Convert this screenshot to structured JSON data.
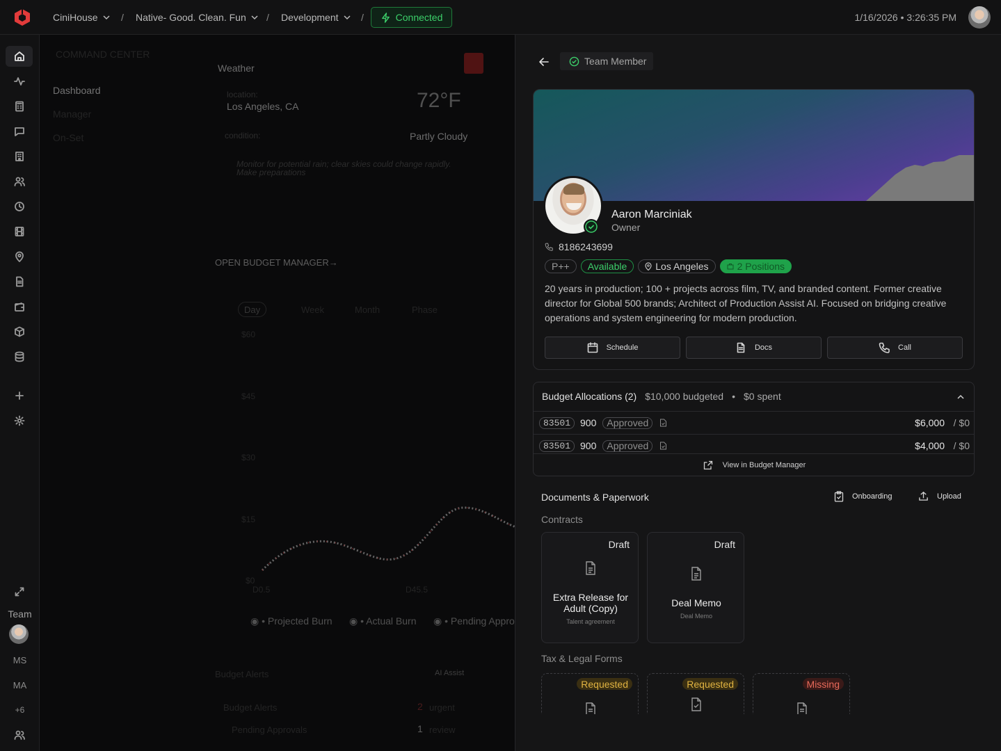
{
  "topbar": {
    "workspace": "CiniHouse",
    "project": "Native- Good. Clean. Fun",
    "phase": "Development",
    "status": "Connected",
    "datetime": "1/16/2026 • 3:26:35 PM"
  },
  "sidebar": {
    "items": [
      "home",
      "activity",
      "calculator",
      "messages",
      "building",
      "users",
      "clock",
      "film",
      "location",
      "document",
      "wallet",
      "package",
      "database",
      "add",
      "settings"
    ],
    "team_label": "Team",
    "team_initials": [
      "MS",
      "MA",
      "+6"
    ]
  },
  "background": {
    "command_center": "COMMAND CENTER",
    "nav": [
      "Dashboard",
      "Manager",
      "On-Set"
    ],
    "weather_title": "Weather",
    "location_label": "location:",
    "location_value": "Los Angeles, CA",
    "temperature": "72°F",
    "condition_label": "condition:",
    "condition_value": "Partly Cloudy",
    "weather_note": "Monitor for potential rain; clear skies could change rapidly. Make preparations",
    "budget_link": "OPEN BUDGET MANAGER→",
    "ranges": [
      "Day",
      "Week",
      "Month",
      "Phase"
    ],
    "y_ticks": [
      "$60",
      "$45",
      "$30",
      "$15",
      "$0"
    ],
    "x_ticks": [
      "D0.5",
      "D45.5"
    ],
    "legend": [
      "Projected Burn",
      "Actual Burn",
      "Pending Appro"
    ],
    "alerts_title": "Budget Alerts",
    "ai_assist": "AI Assist",
    "alerts": [
      {
        "label": "Budget Alerts",
        "count": "2",
        "status": "urgent"
      },
      {
        "label": "Pending Approvals",
        "count": "1",
        "status": "review"
      }
    ]
  },
  "panel": {
    "badge": "Team Member",
    "person": {
      "name": "Aaron Marciniak",
      "role": "Owner",
      "phone": "8186243699",
      "tags": {
        "level": "P++",
        "availability": "Available",
        "location": "Los Angeles",
        "positions": "2 Positions"
      },
      "bio": "20 years in production; 100 + projects across film, TV, and branded content. Former creative director for Global 500 brands; Architect of Production Assist AI. Focused on bridging creative operations and system engineering for modern production."
    },
    "actions": {
      "schedule": "Schedule",
      "docs": "Docs",
      "call": "Call"
    },
    "budget": {
      "title": "Budget Allocations (2)",
      "budgeted": "$10,000 budgeted",
      "dot": "•",
      "spent": "$0 spent",
      "rows": [
        {
          "code": "83501",
          "account": "900",
          "status": "Approved",
          "amount": "$6,000",
          "spent": "/ $0"
        },
        {
          "code": "83501",
          "account": "900",
          "status": "Approved",
          "amount": "$4,000",
          "spent": "/ $0"
        }
      ],
      "view_link": "View in Budget Manager"
    },
    "documents": {
      "title": "Documents & Paperwork",
      "onboarding": "Onboarding",
      "upload": "Upload",
      "contracts_label": "Contracts",
      "contracts": [
        {
          "status": "Draft",
          "name": "Extra Release for Adult (Copy)",
          "type": "Talent agreement"
        },
        {
          "status": "Draft",
          "name": "Deal Memo",
          "type": "Deal Memo"
        }
      ],
      "tax_label": "Tax & Legal Forms",
      "tax_forms": [
        {
          "status": "Requested"
        },
        {
          "status": "Requested"
        },
        {
          "status": "Missing"
        }
      ]
    }
  },
  "colors": {
    "accent_green": "#3ccf6a",
    "banner_start": "#15585a",
    "banner_end": "#6a3aa8",
    "logo_red": "#e23b3b"
  }
}
